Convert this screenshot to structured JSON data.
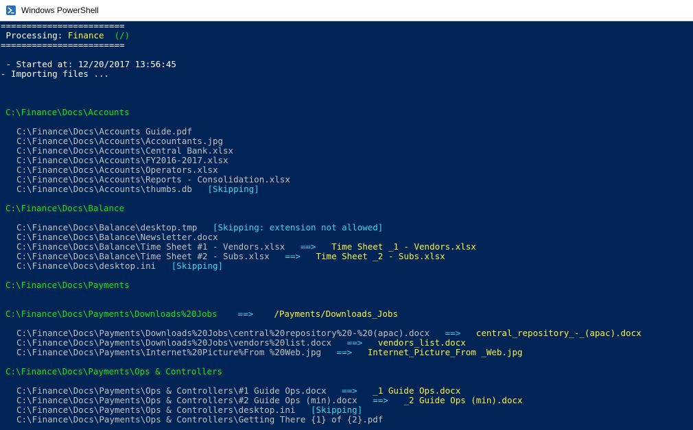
{
  "window": {
    "title": "Windows PowerShell"
  },
  "console": {
    "sep": "========================",
    "processing_label": " Processing: ",
    "processing_value": "Finance",
    "processing_extra": "  (/)",
    "started": " - Started at: 12/20/2017 13:56:45",
    "importing": "- Importing files ...",
    "sections": [
      {
        "header": "C:\\Finance\\Docs\\Accounts",
        "lines": [
          {
            "path": "C:\\Finance\\Docs\\Accounts Guide.pdf"
          },
          {
            "path": "C:\\Finance\\Docs\\Accounts\\Accountants.jpg"
          },
          {
            "path": "C:\\Finance\\Docs\\Accounts\\Central Bank.xlsx"
          },
          {
            "path": "C:\\Finance\\Docs\\Accounts\\FY2016-2017.xlsx"
          },
          {
            "path": "C:\\Finance\\Docs\\Accounts\\Operators.xlsx"
          },
          {
            "path": "C:\\Finance\\Docs\\Accounts\\Reports - Consolidation.xlsx"
          },
          {
            "path": "C:\\Finance\\Docs\\Accounts\\thumbs.db",
            "note": "[Skipping]"
          }
        ]
      },
      {
        "header": "C:\\Finance\\Docs\\Balance",
        "lines": [
          {
            "path": "C:\\Finance\\Docs\\Balance\\desktop.tmp",
            "note": "[Skipping: extension not allowed]"
          },
          {
            "path": "C:\\Finance\\Docs\\Balance\\Newsletter.docx"
          },
          {
            "path": "C:\\Finance\\Docs\\Balance\\Time Sheet #1 - Vendors.xlsx",
            "arrow": "==>",
            "renamed": "Time Sheet _1 - Vendors.xlsx"
          },
          {
            "path": "C:\\Finance\\Docs\\Balance\\Time Sheet #2 - Subs.xlsx",
            "arrow": "==>",
            "renamed": "Time Sheet _2 - Subs.xlsx"
          },
          {
            "path": "C:\\Finance\\Docs\\desktop.ini",
            "note": "[Skipping]"
          }
        ]
      },
      {
        "header": "C:\\Finance\\Docs\\Payments",
        "lines": []
      },
      {
        "header": "C:\\Finance\\Docs\\Payments\\Downloads%20Jobs",
        "header_arrow": "==>",
        "header_renamed": "/Payments/Downloads_Jobs",
        "lines": [
          {
            "path": "C:\\Finance\\Docs\\Payments\\Downloads%20Jobs\\central%20repository%20-%20(apac).docx",
            "arrow": "==>",
            "renamed": "central_repository_-_(apac).docx"
          },
          {
            "path": "C:\\Finance\\Docs\\Payments\\Downloads%20Jobs\\vendors%20list.docx",
            "arrow": "==>",
            "renamed": "vendors_list.docx"
          },
          {
            "path": "C:\\Finance\\Docs\\Payments\\Internet%20Picture%From %20Web.jpg",
            "arrow": "==>",
            "renamed": "Internet_Picture_From _Web.jpg"
          }
        ]
      },
      {
        "header": "C:\\Finance\\Docs\\Payments\\Ops & Controllers",
        "lines": [
          {
            "path": "C:\\Finance\\Docs\\Payments\\Ops & Controllers\\#1 Guide Ops.docx",
            "arrow": "==>",
            "renamed": "_1 Guide Ops.docx"
          },
          {
            "path": "C:\\Finance\\Docs\\Payments\\Ops & Controllers\\#2 Guide Ops (min).docx",
            "arrow": "==>",
            "renamed": "_2 Guide Ops (min).docx"
          },
          {
            "path": "C:\\Finance\\Docs\\Payments\\Ops & Controllers\\desktop.ini",
            "note": "[Skipping]"
          },
          {
            "path": "C:\\Finance\\Docs\\Payments\\Ops & Controllers\\Getting There {1} of {2}.pdf"
          }
        ]
      }
    ]
  }
}
